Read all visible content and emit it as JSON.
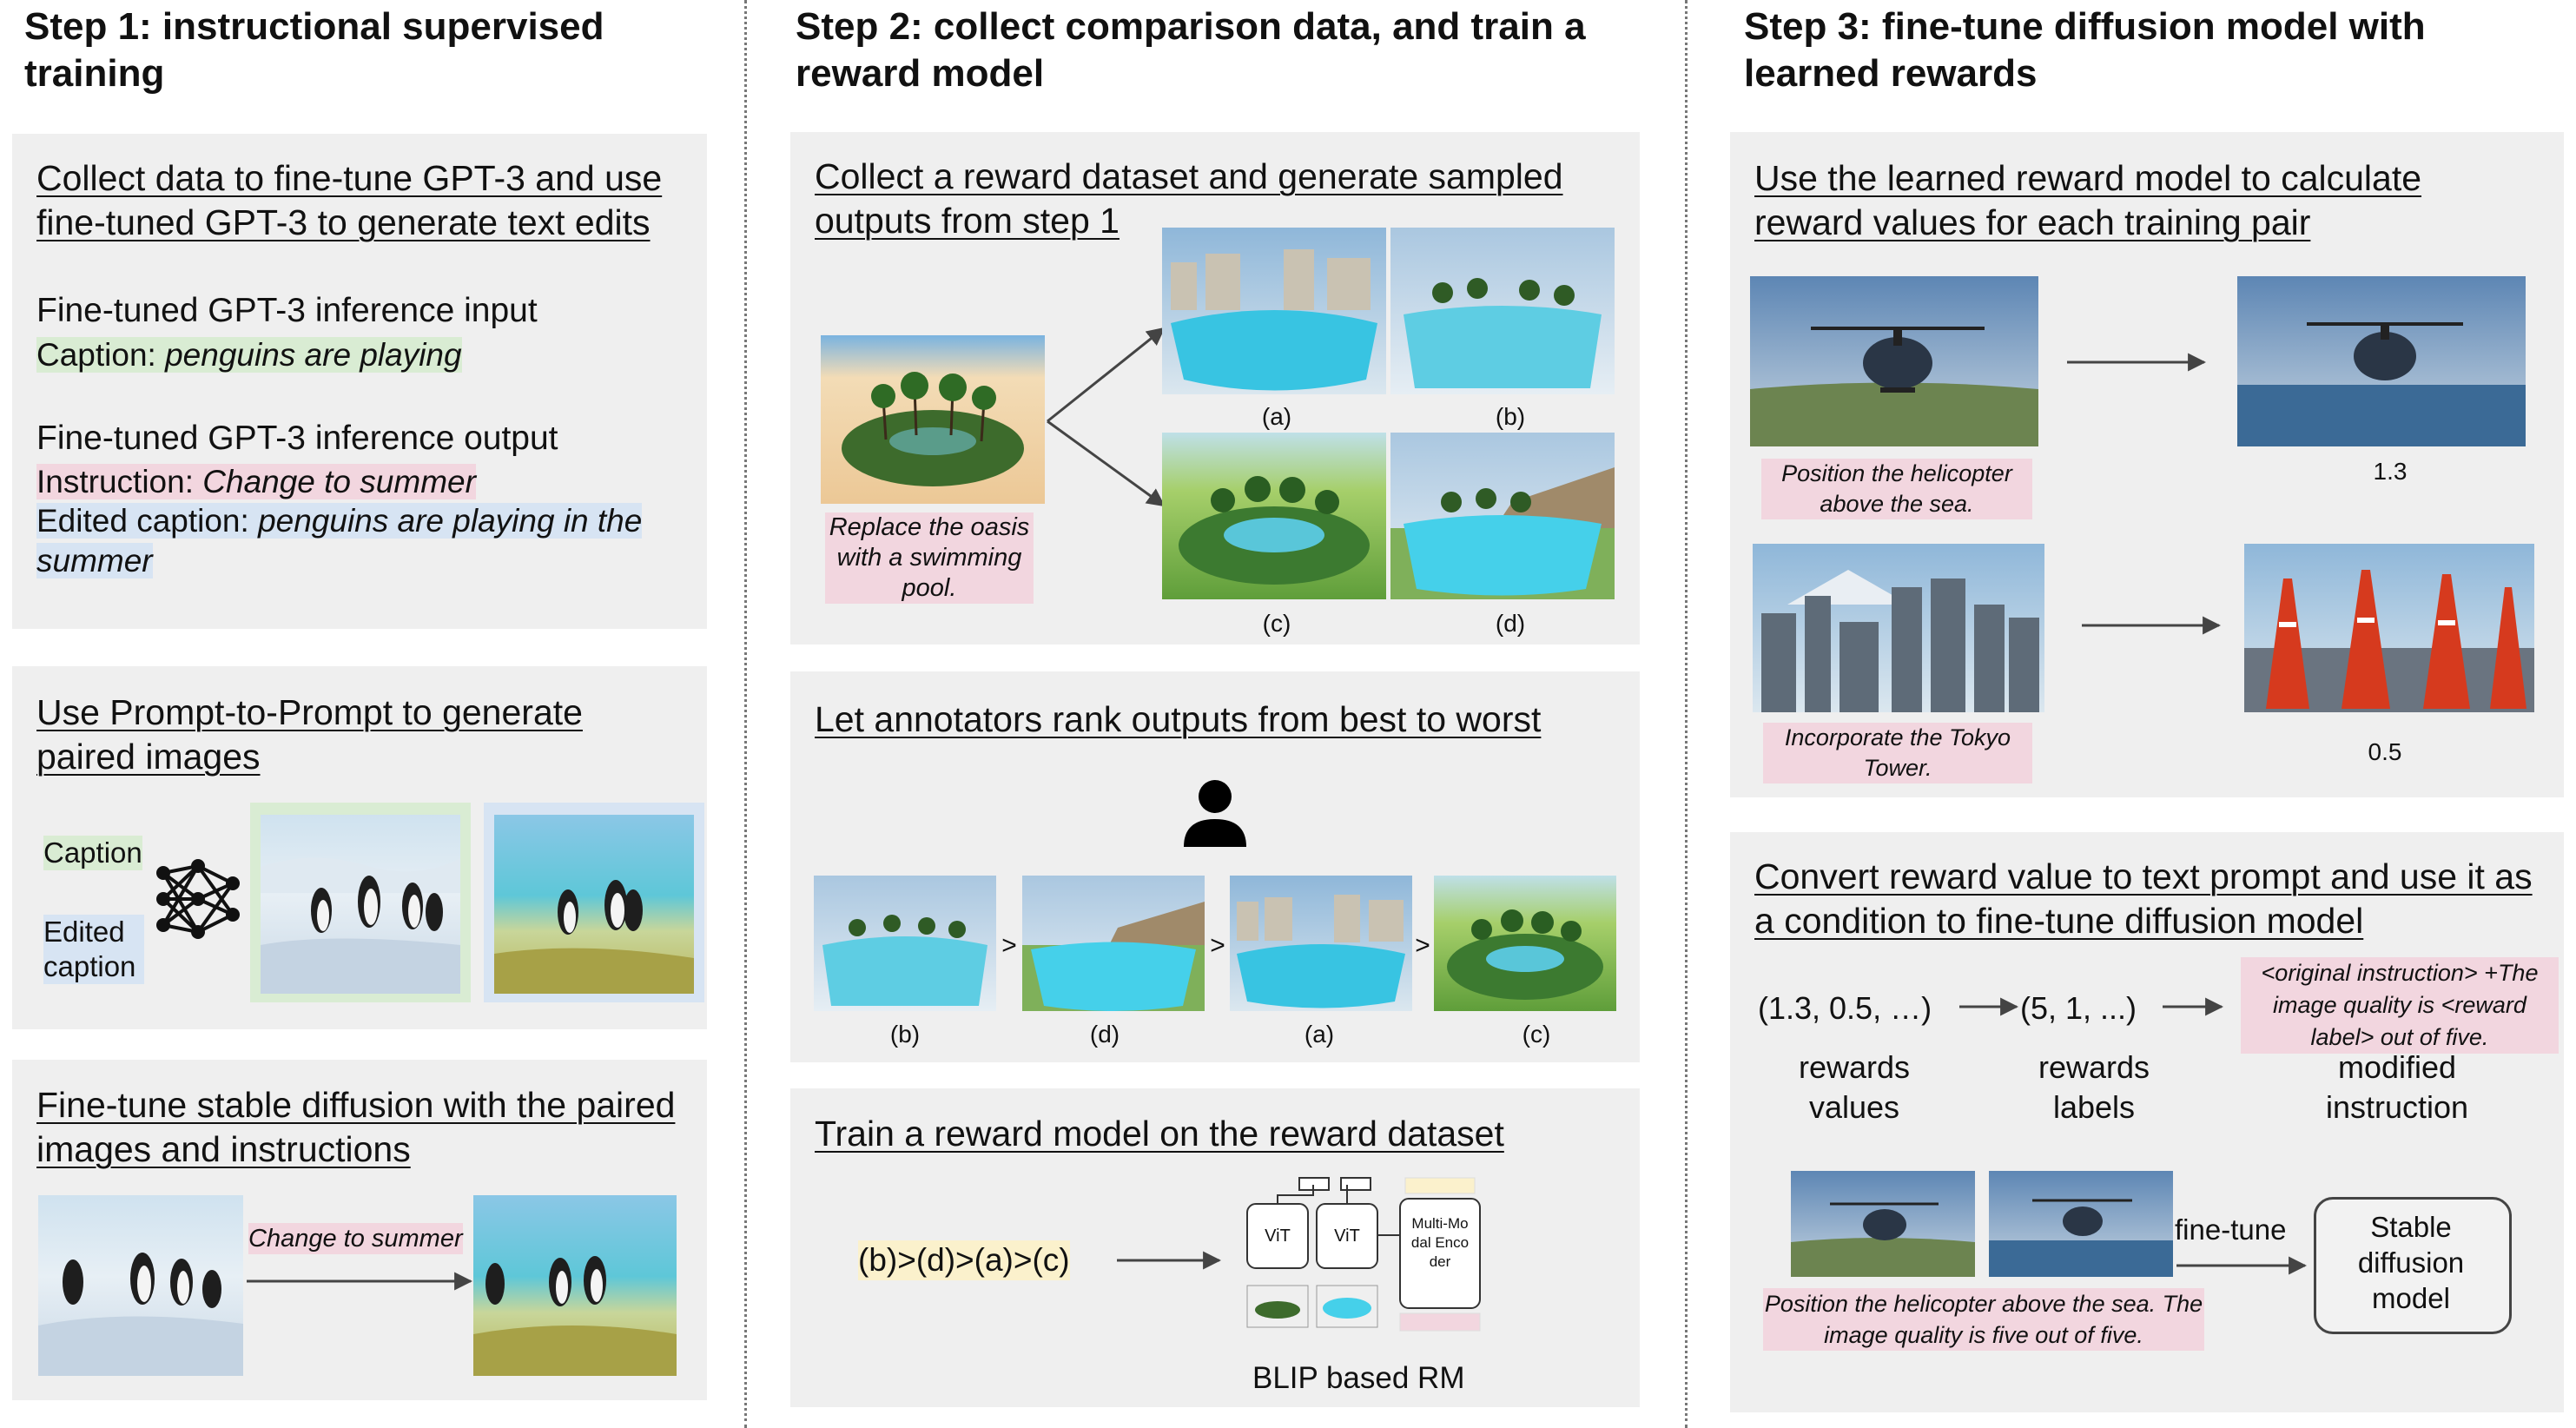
{
  "steps": [
    {
      "title": "Step 1: instructional supervised training"
    },
    {
      "title": "Step 2: collect comparison data, and train a reward model"
    },
    {
      "title": "Step 3: fine-tune diffusion model with learned rewards"
    }
  ],
  "step1": {
    "panel1": {
      "title": "Collect data to fine-tune GPT-3 and use fine-tuned GPT-3 to generate text edits",
      "input_heading": "Fine-tuned GPT-3 inference input",
      "caption_label": "Caption: ",
      "caption_value": "penguins are playing",
      "output_heading": "Fine-tuned GPT-3 inference output",
      "instruction_label": "Instruction: ",
      "instruction_value": "Change to summer",
      "edited_label": "Edited caption: ",
      "edited_value": "penguins are playing in the summer"
    },
    "panel2": {
      "title": "Use Prompt-to-Prompt to generate paired images",
      "caption": "Caption",
      "edited_caption": "Edited caption",
      "icon": "neural-network-icon"
    },
    "panel3": {
      "title": "Fine-tune stable diffusion with the paired images and instructions",
      "instruction": "Change to summer"
    }
  },
  "step2": {
    "panel1": {
      "title": "Collect a reward dataset and generate sampled outputs from step 1",
      "instruction": "Replace the oasis with a swimming pool.",
      "labels": [
        "(a)",
        "(b)",
        "(c)",
        "(d)"
      ]
    },
    "panel2": {
      "title": "Let annotators rank outputs from best to worst",
      "icon": "person-icon",
      "ranking": [
        "(b)",
        "(d)",
        "(a)",
        "(c)"
      ],
      "separator": ">"
    },
    "panel3": {
      "title": "Train a reward model on the reward dataset",
      "ranking_text": "(b)>(d)>(a)>(c)",
      "vit": "ViT",
      "mm_encoder": "Multi-Modal Encoder",
      "rm_label": "BLIP based RM"
    }
  },
  "step3": {
    "panel1": {
      "title": "Use the learned reward model to calculate reward values for each training pair",
      "pairs": [
        {
          "instruction": "Position the helicopter above the sea.",
          "reward": "1.3"
        },
        {
          "instruction": "Incorporate the Tokyo Tower.",
          "reward": "0.5"
        }
      ]
    },
    "panel2": {
      "title": "Convert reward value to text prompt and use it as a condition to fine-tune diffusion model",
      "values": "(1.3, 0.5, …)",
      "labels": "(5, 1, ...)",
      "template": "<original instruction> +The image quality is <reward label> out of five.",
      "col1": "rewards values",
      "col2": "rewards labels",
      "col3": "modified instruction",
      "finetune": "fine-tune",
      "model": "Stable diffusion model",
      "caption": "Position the helicopter above the sea. The image quality is five out of five."
    }
  }
}
